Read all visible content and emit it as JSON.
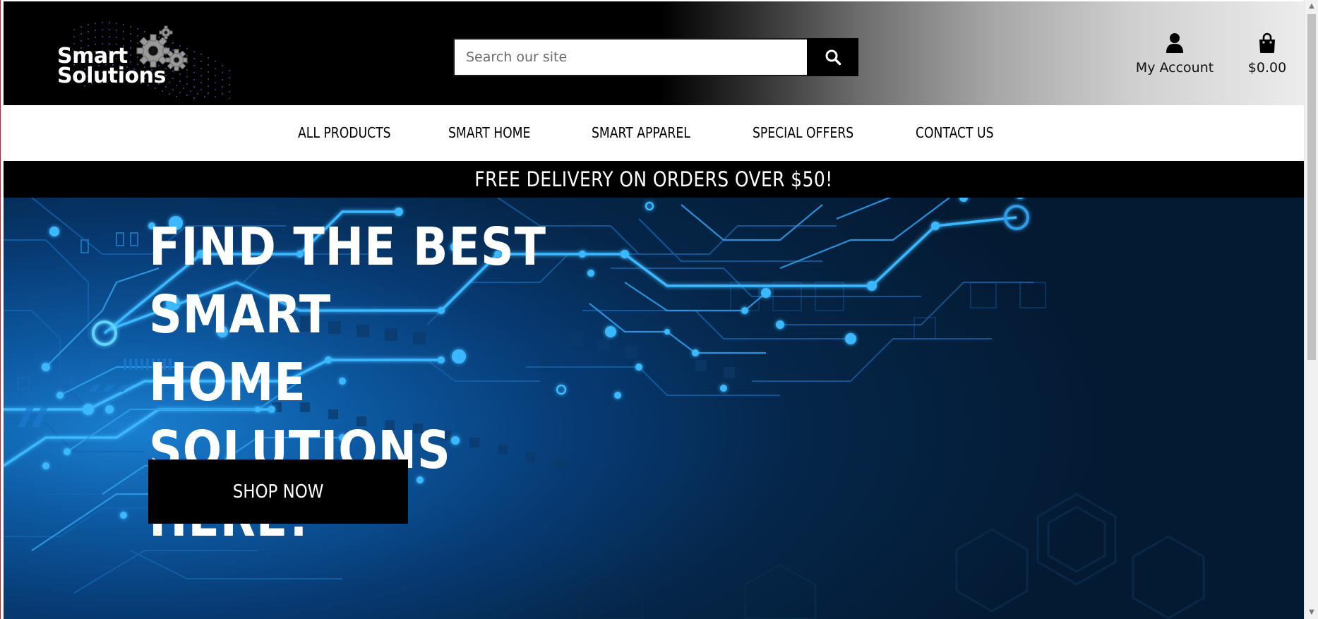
{
  "header": {
    "logo": {
      "line1": "Smart",
      "line2": "Solutions"
    },
    "search": {
      "placeholder": "Search our site"
    },
    "account": {
      "label": "My Account"
    },
    "cart": {
      "total": "$0.00"
    }
  },
  "nav": {
    "items": [
      {
        "label": "ALL PRODUCTS"
      },
      {
        "label": "SMART HOME"
      },
      {
        "label": "SMART APPAREL"
      },
      {
        "label": "SPECIAL OFFERS"
      },
      {
        "label": "CONTACT US"
      }
    ]
  },
  "promo": {
    "text": "FREE DELIVERY ON ORDERS OVER $50!"
  },
  "hero": {
    "title_lines": [
      "FIND THE BEST SMART",
      "HOME SOLUTIONS",
      "HERE!"
    ],
    "cta_label": "SHOP NOW"
  },
  "colors": {
    "header_dark": "#000000",
    "header_light": "#ececec",
    "promo_bg": "#000000",
    "hero_glow": "#1a7fd0",
    "hero_deep": "#041a33",
    "circuit": "#3ab8ff"
  },
  "icons": {
    "search": "search-icon",
    "account": "user-icon",
    "cart": "shopping-bag-icon",
    "logo": "gears-icon"
  }
}
